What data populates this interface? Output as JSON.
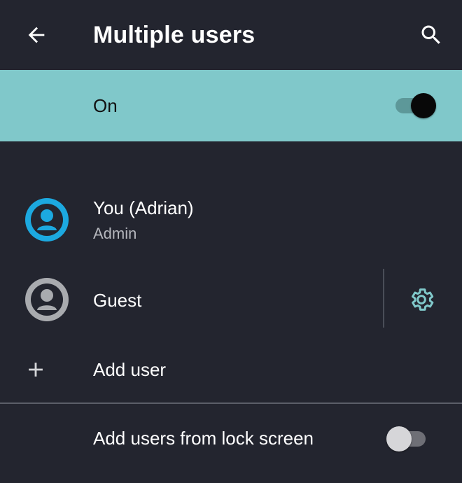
{
  "header": {
    "title": "Multiple users",
    "back_icon": "arrow-back-icon",
    "search_icon": "search-icon"
  },
  "master_switch": {
    "label": "On",
    "checked": true,
    "background": "#80c8ca"
  },
  "users": [
    {
      "name": "You (Adrian)",
      "subtitle": "Admin",
      "icon": "account-circle-icon",
      "avatar_color": "#1ca9e0"
    },
    {
      "name": "Guest",
      "icon": "account-circle-icon",
      "avatar_color": "#a9abaf",
      "settings_icon": "gear-icon"
    }
  ],
  "add_user": {
    "label": "Add user",
    "icon": "plus-icon"
  },
  "lock_screen": {
    "label": "Add users from lock screen",
    "checked": false
  },
  "colors": {
    "background": "#23252f",
    "accent": "#80c8ca",
    "admin_avatar": "#1ca9e0"
  }
}
